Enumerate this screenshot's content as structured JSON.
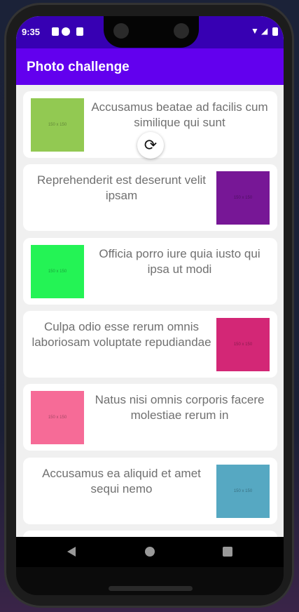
{
  "status_bar": {
    "time": "9:35",
    "icons": [
      "a-icon",
      "p-icon",
      "sd-card-icon",
      "wifi-icon",
      "signal-icon",
      "battery-icon"
    ]
  },
  "app_bar": {
    "title": "Photo challenge"
  },
  "refresh_icon": "refresh-icon",
  "items": [
    {
      "text": "Accusamus beatae ad facilis cum similique qui sunt",
      "image_label": "150 x 150",
      "color": "#92c952",
      "side": "left"
    },
    {
      "text": "Reprehenderit est deserunt velit ipsam",
      "image_label": "150 x 150",
      "color": "#771796",
      "side": "right"
    },
    {
      "text": "Officia porro iure quia iusto qui ipsa ut modi",
      "image_label": "150 x 150",
      "color": "#24f355",
      "side": "left"
    },
    {
      "text": "Culpa odio esse rerum omnis laboriosam voluptate repudiandae",
      "image_label": "150 x 150",
      "color": "#d32776",
      "side": "right"
    },
    {
      "text": "Natus nisi omnis corporis facere molestiae rerum in",
      "image_label": "150 x 150",
      "color": "#f66b97",
      "side": "left"
    },
    {
      "text": "Accusamus ea aliquid et amet sequi nemo",
      "image_label": "150 x 150",
      "color": "#56a8c2",
      "side": "right"
    }
  ],
  "nav_bar": {
    "back": "back-icon",
    "home": "home-icon",
    "recents": "recents-icon"
  }
}
